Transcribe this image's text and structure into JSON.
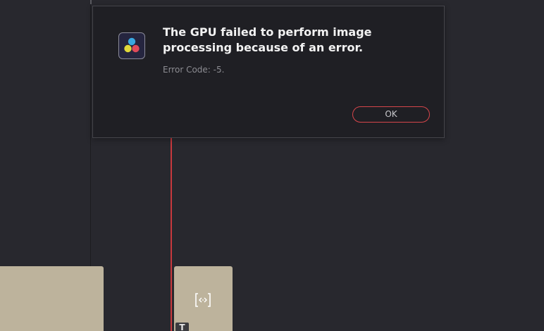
{
  "dialog": {
    "title": "The GPU failed to perform image processing because of an error.",
    "error_code": "Error Code: -5.",
    "ok_label": "OK",
    "app_icon": "davinci-resolve-icon"
  },
  "timeline": {
    "clip_badge": "T",
    "clip_effect_icon": "fx-brackets-icon",
    "playhead_color": "#c8383d",
    "clip_color": "#bdb39c"
  },
  "colors": {
    "background": "#28282e",
    "dialog_background": "#1f1f24",
    "accent": "#d6454b"
  }
}
